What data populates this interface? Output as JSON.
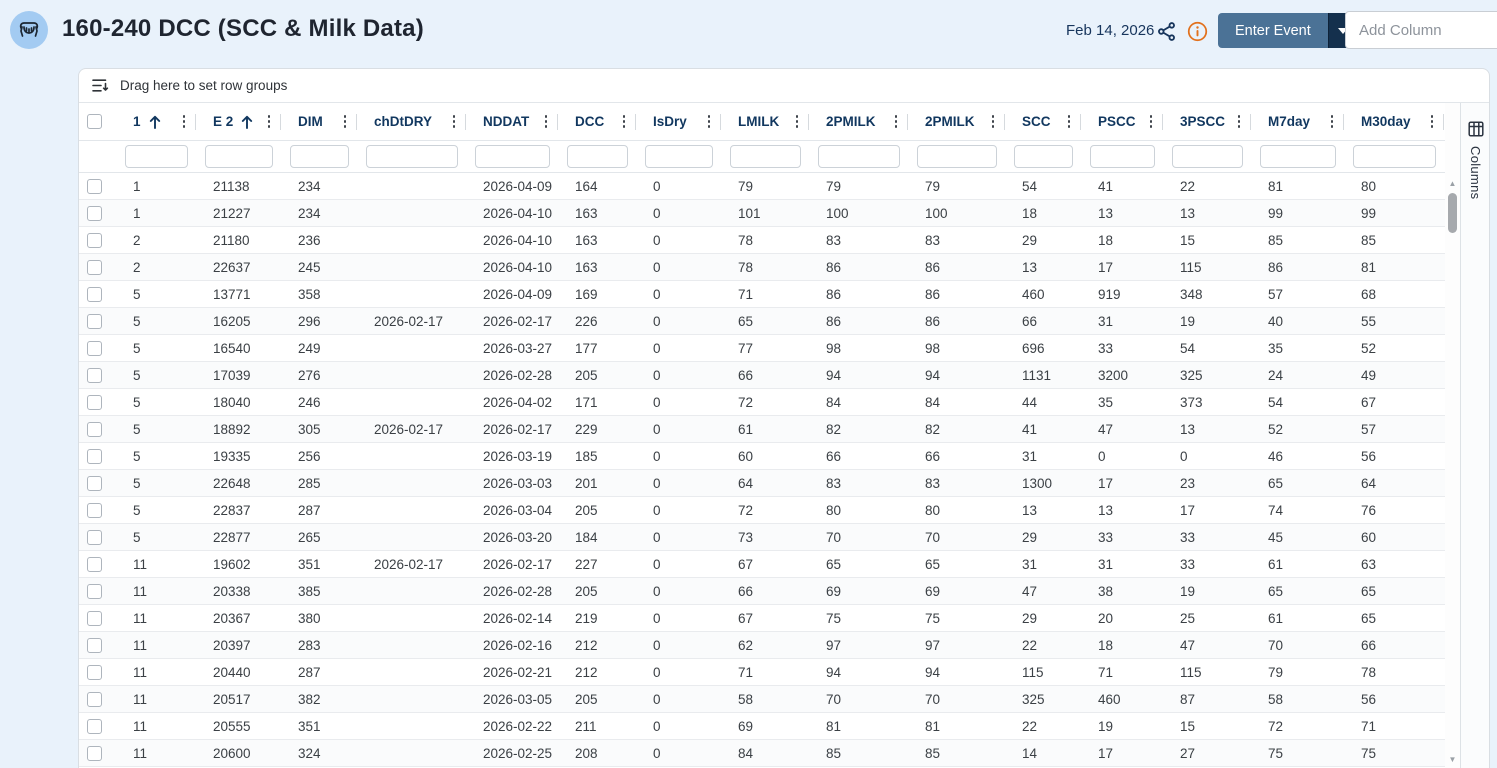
{
  "header": {
    "title": "160-240 DCC (SCC & Milk Data)",
    "date": "Feb 14, 2026",
    "enter_event_label": "Enter Event",
    "add_column_placeholder": "Add Column",
    "icons": {
      "logo": "cow-icon",
      "share": "share-icon",
      "info": "info-icon",
      "caret": "caret-down-icon"
    }
  },
  "grid": {
    "row_group_hint": "Drag here to set row groups",
    "side_panel_tab_label": "Columns",
    "columns": [
      {
        "label": "1",
        "sorted": "asc"
      },
      {
        "label": "E 2",
        "sorted": "asc"
      },
      {
        "label": "DIM",
        "sorted": ""
      },
      {
        "label": "chDtDRY",
        "sorted": ""
      },
      {
        "label": "NDDAT",
        "sorted": ""
      },
      {
        "label": "DCC",
        "sorted": ""
      },
      {
        "label": "IsDry",
        "sorted": ""
      },
      {
        "label": "LMILK",
        "sorted": ""
      },
      {
        "label": "2PMILK",
        "sorted": ""
      },
      {
        "label": "2PMILK",
        "sorted": ""
      },
      {
        "label": "SCC",
        "sorted": ""
      },
      {
        "label": "PSCC",
        "sorted": ""
      },
      {
        "label": "3PSCC",
        "sorted": ""
      },
      {
        "label": "M7day",
        "sorted": ""
      },
      {
        "label": "M30day",
        "sorted": ""
      }
    ],
    "rows": [
      [
        "1",
        "21138",
        "234",
        "",
        "2026-04-09",
        "164",
        "0",
        "79",
        "79",
        "79",
        "54",
        "41",
        "22",
        "81",
        "80"
      ],
      [
        "1",
        "21227",
        "234",
        "",
        "2026-04-10",
        "163",
        "0",
        "101",
        "100",
        "100",
        "18",
        "13",
        "13",
        "99",
        "99"
      ],
      [
        "2",
        "21180",
        "236",
        "",
        "2026-04-10",
        "163",
        "0",
        "78",
        "83",
        "83",
        "29",
        "18",
        "15",
        "85",
        "85"
      ],
      [
        "2",
        "22637",
        "245",
        "",
        "2026-04-10",
        "163",
        "0",
        "78",
        "86",
        "86",
        "13",
        "17",
        "115",
        "86",
        "81"
      ],
      [
        "5",
        "13771",
        "358",
        "",
        "2026-04-09",
        "169",
        "0",
        "71",
        "86",
        "86",
        "460",
        "919",
        "348",
        "57",
        "68"
      ],
      [
        "5",
        "16205",
        "296",
        "2026-02-17",
        "2026-02-17",
        "226",
        "0",
        "65",
        "86",
        "86",
        "66",
        "31",
        "19",
        "40",
        "55"
      ],
      [
        "5",
        "16540",
        "249",
        "",
        "2026-03-27",
        "177",
        "0",
        "77",
        "98",
        "98",
        "696",
        "33",
        "54",
        "35",
        "52"
      ],
      [
        "5",
        "17039",
        "276",
        "",
        "2026-02-28",
        "205",
        "0",
        "66",
        "94",
        "94",
        "1131",
        "3200",
        "325",
        "24",
        "49"
      ],
      [
        "5",
        "18040",
        "246",
        "",
        "2026-04-02",
        "171",
        "0",
        "72",
        "84",
        "84",
        "44",
        "35",
        "373",
        "54",
        "67"
      ],
      [
        "5",
        "18892",
        "305",
        "2026-02-17",
        "2026-02-17",
        "229",
        "0",
        "61",
        "82",
        "82",
        "41",
        "47",
        "13",
        "52",
        "57"
      ],
      [
        "5",
        "19335",
        "256",
        "",
        "2026-03-19",
        "185",
        "0",
        "60",
        "66",
        "66",
        "31",
        "0",
        "0",
        "46",
        "56"
      ],
      [
        "5",
        "22648",
        "285",
        "",
        "2026-03-03",
        "201",
        "0",
        "64",
        "83",
        "83",
        "1300",
        "17",
        "23",
        "65",
        "64"
      ],
      [
        "5",
        "22837",
        "287",
        "",
        "2026-03-04",
        "205",
        "0",
        "72",
        "80",
        "80",
        "13",
        "13",
        "17",
        "74",
        "76"
      ],
      [
        "5",
        "22877",
        "265",
        "",
        "2026-03-20",
        "184",
        "0",
        "73",
        "70",
        "70",
        "29",
        "33",
        "33",
        "45",
        "60"
      ],
      [
        "11",
        "19602",
        "351",
        "2026-02-17",
        "2026-02-17",
        "227",
        "0",
        "67",
        "65",
        "65",
        "31",
        "31",
        "33",
        "61",
        "63"
      ],
      [
        "11",
        "20338",
        "385",
        "",
        "2026-02-28",
        "205",
        "0",
        "66",
        "69",
        "69",
        "47",
        "38",
        "19",
        "65",
        "65"
      ],
      [
        "11",
        "20367",
        "380",
        "",
        "2026-02-14",
        "219",
        "0",
        "67",
        "75",
        "75",
        "29",
        "20",
        "25",
        "61",
        "65"
      ],
      [
        "11",
        "20397",
        "283",
        "",
        "2026-02-16",
        "212",
        "0",
        "62",
        "97",
        "97",
        "22",
        "18",
        "47",
        "70",
        "66"
      ],
      [
        "11",
        "20440",
        "287",
        "",
        "2026-02-21",
        "212",
        "0",
        "71",
        "94",
        "94",
        "115",
        "71",
        "115",
        "79",
        "78"
      ],
      [
        "11",
        "20517",
        "382",
        "",
        "2026-03-05",
        "205",
        "0",
        "58",
        "70",
        "70",
        "325",
        "460",
        "87",
        "58",
        "56"
      ],
      [
        "11",
        "20555",
        "351",
        "",
        "2026-02-22",
        "211",
        "0",
        "69",
        "81",
        "81",
        "22",
        "19",
        "15",
        "72",
        "71"
      ],
      [
        "11",
        "20600",
        "324",
        "",
        "2026-02-25",
        "208",
        "0",
        "84",
        "85",
        "85",
        "14",
        "17",
        "27",
        "75",
        "75"
      ]
    ]
  },
  "colors": {
    "page_background": "#e9f2fb",
    "logo_circle": "#a3cbf2",
    "header_text_navy": "#11375f",
    "button_steel_blue": "#4b7296",
    "button_caret_navy": "#14304d",
    "info_orange": "#e2711d",
    "row_text": "#3b4045"
  }
}
